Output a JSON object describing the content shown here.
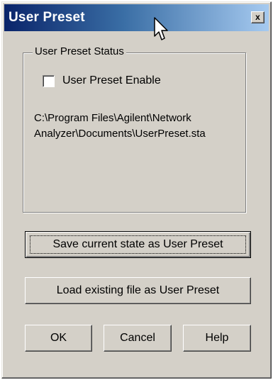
{
  "window": {
    "title": "User Preset",
    "close_label": "x"
  },
  "group": {
    "legend": "User Preset Status",
    "checkbox_label": "User Preset Enable",
    "checkbox_checked": false,
    "path_line1": "C:\\Program Files\\Agilent\\Network",
    "path_line2": "Analyzer\\Documents\\UserPreset.sta"
  },
  "buttons": {
    "save_label": "Save current state as User Preset",
    "load_label": "Load existing file as User Preset",
    "ok_label": "OK",
    "cancel_label": "Cancel",
    "help_label": "Help"
  },
  "colors": {
    "titlebar_start": "#0a246a",
    "titlebar_end": "#a6caf0",
    "dialog_face": "#d4d0c8"
  },
  "icons": {
    "cursor": "mouse-pointer-icon"
  }
}
